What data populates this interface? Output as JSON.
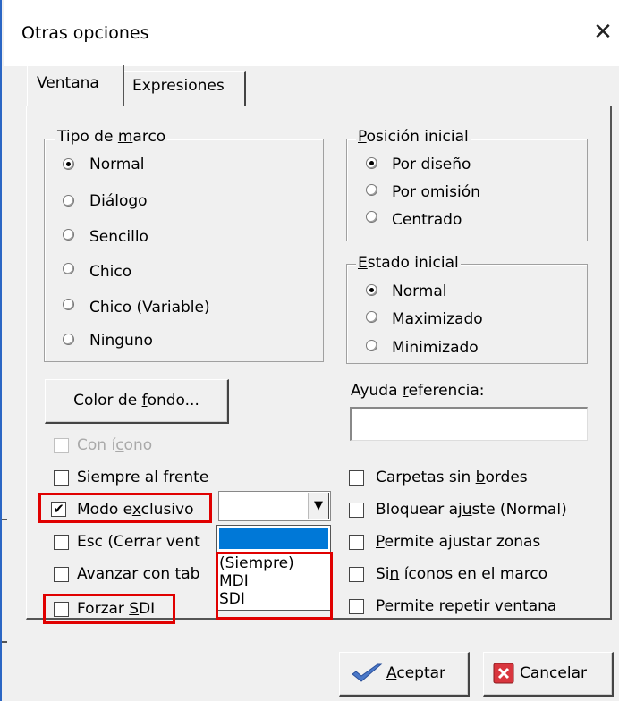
{
  "window": {
    "title": "Otras opciones",
    "close_symbol": "✕"
  },
  "tabs": [
    {
      "label": "Ventana",
      "active": true
    },
    {
      "label": "Expresiones",
      "active": false
    }
  ],
  "frame_type": {
    "legend_pre": "Tipo de ",
    "legend_u": "m",
    "legend_post": "arco",
    "options": [
      {
        "label": "Normal",
        "selected": true
      },
      {
        "label": "Diálogo",
        "selected": false
      },
      {
        "label": "Sencillo",
        "selected": false
      },
      {
        "label": "Chico",
        "selected": false
      },
      {
        "label": "Chico (Variable)",
        "selected": false
      },
      {
        "label": "Ninguno",
        "selected": false
      }
    ]
  },
  "initial_position": {
    "legend_u": "P",
    "legend_post": "osición inicial",
    "options": [
      {
        "label": "Por diseño",
        "selected": true
      },
      {
        "label": "Por omisión",
        "selected": false
      },
      {
        "label": "Centrado",
        "selected": false
      }
    ]
  },
  "initial_state": {
    "legend_u": "E",
    "legend_post": "stado inicial",
    "options": [
      {
        "label": "Normal",
        "selected": true
      },
      {
        "label": "Maximizado",
        "selected": false
      },
      {
        "label": "Minimizado",
        "selected": false
      }
    ]
  },
  "background_color_button": {
    "pre": "Color de ",
    "u": "f",
    "post": "ondo..."
  },
  "help_reference": {
    "pre": "Ayuda ",
    "u": "r",
    "post": "eferencia:",
    "value": ""
  },
  "left_checks": [
    {
      "pre": "Con í",
      "u": "c",
      "post": "ono",
      "checked": false,
      "disabled": true
    },
    {
      "pre": "Siempre al frente",
      "u": "",
      "post": "",
      "checked": false,
      "disabled": false
    },
    {
      "pre": "Modo e",
      "u": "x",
      "post": "clusivo",
      "checked": true,
      "disabled": false
    },
    {
      "pre": "Esc (Cerrar vent",
      "u": "",
      "post": "",
      "checked": false,
      "disabled": false
    },
    {
      "pre": "Avanzar con tab",
      "u": "",
      "post": "",
      "checked": false,
      "disabled": false
    },
    {
      "pre": "Forzar ",
      "u": "S",
      "post": "DI",
      "checked": false,
      "disabled": false
    }
  ],
  "right_checks": [
    {
      "pre": "Carpetas sin ",
      "u": "b",
      "post": "ordes",
      "checked": false
    },
    {
      "pre": "Bloquear aj",
      "u": "u",
      "post": "ste (Normal)",
      "checked": false
    },
    {
      "pre": "",
      "u": "P",
      "post": "ermite ajustar zonas",
      "checked": false
    },
    {
      "pre": "Si",
      "u": "n",
      "post": " íconos en el marco",
      "checked": false
    },
    {
      "pre": "P",
      "u": "e",
      "post": "rmite repetir ventana",
      "checked": false
    }
  ],
  "exclusive_mode_combo": {
    "selected_value": "",
    "options": [
      "(Siempre)",
      "MDI",
      "SDI"
    ]
  },
  "buttons": {
    "accept": {
      "u": "A",
      "post": "ceptar"
    },
    "cancel": {
      "label": "Cancelar"
    }
  },
  "colors": {
    "highlight": "#e00000",
    "selection": "#0078d7",
    "accent": "#2b66c4"
  }
}
